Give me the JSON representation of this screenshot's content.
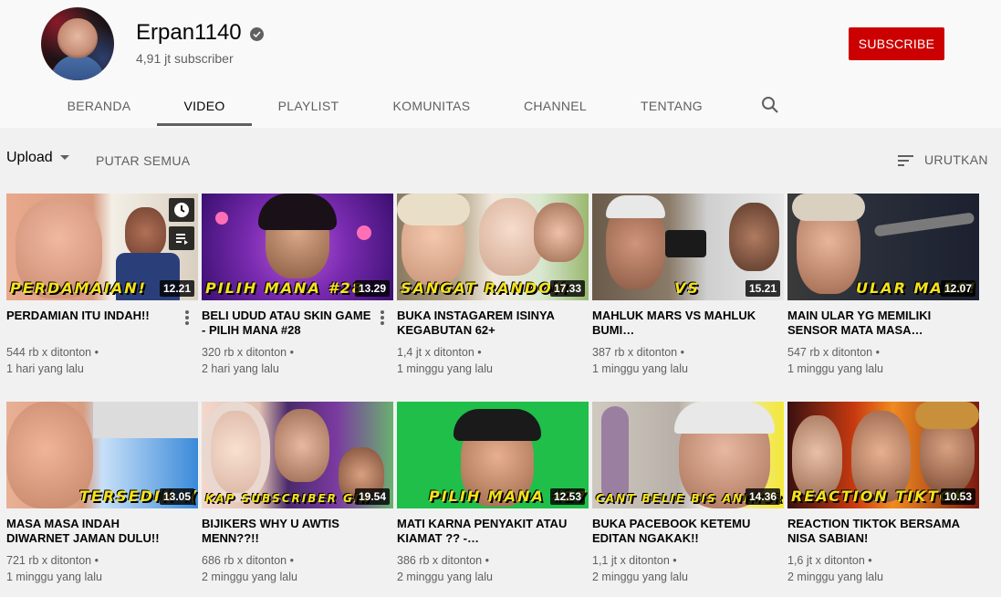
{
  "channel": {
    "name": "Erpan1140",
    "subscribers": "4,91 jt subscriber",
    "subscribe_label": "SUBSCRIBE",
    "verified_icon": "verified-check-icon"
  },
  "tabs": [
    {
      "label": "BERANDA"
    },
    {
      "label": "VIDEO",
      "active": true
    },
    {
      "label": "PLAYLIST"
    },
    {
      "label": "KOMUNITAS"
    },
    {
      "label": "CHANNEL"
    },
    {
      "label": "TENTANG"
    }
  ],
  "toolbar": {
    "upload_label": "Upload",
    "play_all_label": "PUTAR SEMUA",
    "sort_label": "URUTKAN"
  },
  "videos": [
    {
      "title": "PERDAMIAN ITU INDAH!!",
      "views": "544 rb x ditonton",
      "age": "1 hari yang lalu",
      "duration": "12.21",
      "caption": "PERDAMAIAN!"
    },
    {
      "title": "BELI UDUD ATAU SKIN GAME - PILIH MANA #28",
      "views": "320 rb x ditonton",
      "age": "2 hari yang lalu",
      "duration": "13.29",
      "caption": "PILIH MANA #28"
    },
    {
      "title": "BUKA INSTAGAREM ISINYA KEGABUTAN 62+",
      "views": "1,4 jt x ditonton",
      "age": "1 minggu yang lalu",
      "duration": "17.33",
      "caption": "SANGAT RANDOM"
    },
    {
      "title": "MAHLUK MARS VS MAHLUK BUMI…",
      "views": "387 rb x ditonton",
      "age": "1 minggu yang lalu",
      "duration": "15.21",
      "caption": "VS"
    },
    {
      "title": "MAIN ULAR YG MEMILIKI SENSOR MATA MASA…",
      "views": "547 rb x ditonton",
      "age": "1 minggu yang lalu",
      "duration": "12.07",
      "caption": "ULAR MARS!"
    },
    {
      "title": "MASA MASA INDAH DIWARNET JAMAN DULU!!",
      "views": "721 rb x ditonton",
      "age": "1 minggu yang lalu",
      "duration": "13.05",
      "caption": "TERSEDIH :("
    },
    {
      "title": "BIJIKERS WHY U AWTIS MENN??!!",
      "views": "686 rb x ditonton",
      "age": "2 minggu yang lalu",
      "duration": "19.54",
      "caption": "KAP SUBSCRIBER GIN"
    },
    {
      "title": "MATI KARNA PENYAKIT ATAU KIAMAT ?? -…",
      "views": "386 rb x ditonton",
      "age": "2 minggu yang lalu",
      "duration": "12.53",
      "caption": "PILIH MANA #27"
    },
    {
      "title": "BUKA PACEBOOK KETEMU EDITAN NGAKAK!!",
      "views": "1,1 jt x ditonton",
      "age": "2 minggu yang lalu",
      "duration": "14.36",
      "caption": "CANT BELIE BIS ANIMOR"
    },
    {
      "title": "REACTION TIKTOK BERSAMA NISA SABIAN!",
      "views": "1,6 jt x ditonton",
      "age": "2 minggu yang lalu",
      "duration": "10.53",
      "caption": "REACTION TIKTOK"
    }
  ],
  "colors": {
    "subscribe": "#cc0000",
    "caption_yellow": "#f5e21a"
  }
}
